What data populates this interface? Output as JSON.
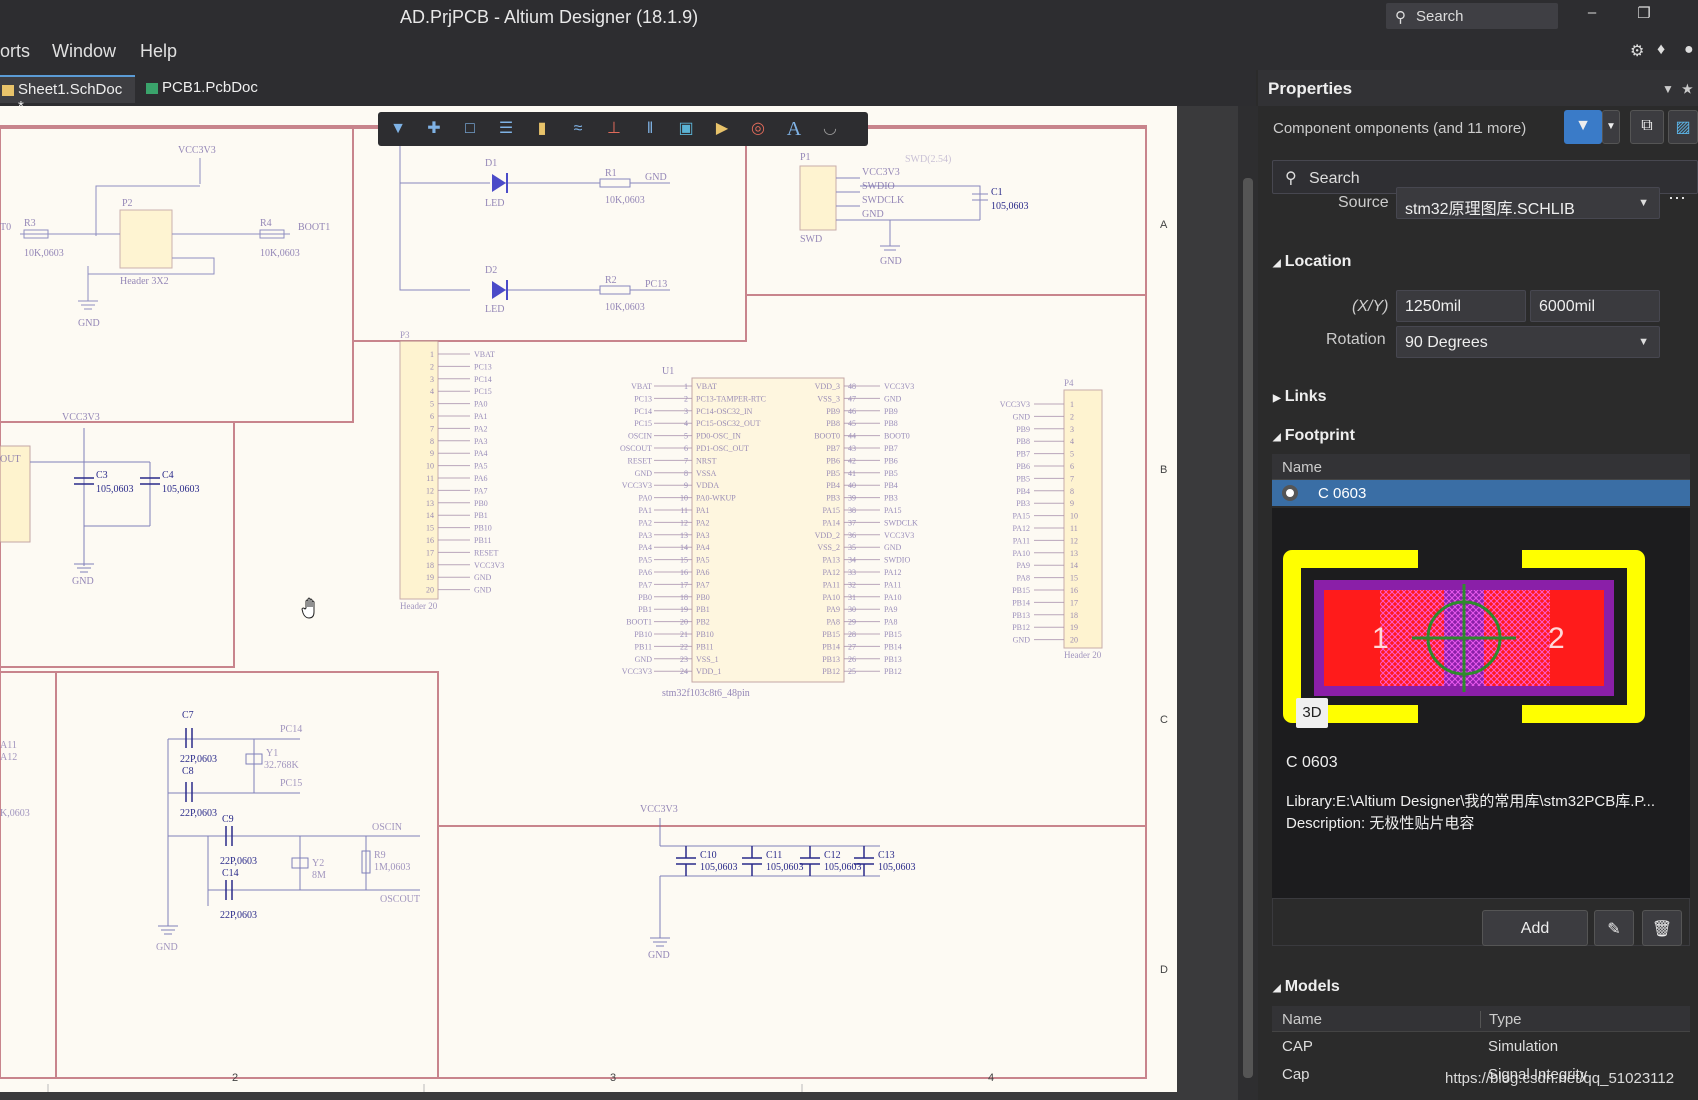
{
  "app": {
    "title": "AD.PrjPCB - Altium Designer (18.1.9)",
    "search_placeholder": "Search"
  },
  "menu": [
    "orts",
    "Window",
    "Help"
  ],
  "tabs": [
    {
      "label": "Sheet1.SchDoc *",
      "active": true
    },
    {
      "label": "PCB1.PcbDoc",
      "active": false
    }
  ],
  "schematic": {
    "border_rows": [
      "A",
      "B",
      "C",
      "D"
    ],
    "border_cols": [
      "2",
      "3",
      "4"
    ],
    "labels": {
      "vcc3v3_top": "VCC3V3",
      "p2": "P2",
      "p2_name": "Header 3X2",
      "r3": "R3",
      "r3_val": "10K,0603",
      "r4": "R4",
      "r4_val": "10K,0603",
      "boot1": "BOOT1",
      "gnd1": "GND",
      "to": "T0",
      "d1": "D1",
      "d1_type": "LED",
      "d2": "D2",
      "d2_type": "LED",
      "r1": "R1",
      "r1_val": "10K,0603",
      "r1_net": "GND",
      "r2": "R2",
      "r2_val": "10K,0603",
      "r2_net": "PC13",
      "vcc3v3_led": "VCC3V3",
      "p1": "P1",
      "swd_label": "SWD",
      "swd_nets": [
        "VCC3V3",
        "SWDIO",
        "SWDCLK",
        "GND"
      ],
      "swd_hdr": "SWD(2.54)",
      "c1": "C1",
      "c1_val": "105,0603",
      "gnd_swd": "GND",
      "p3": "P3",
      "p3_name": "Header 20",
      "p3_pins": [
        "1",
        "2",
        "3",
        "4",
        "5",
        "6",
        "7",
        "8",
        "9",
        "10",
        "11",
        "12",
        "13",
        "14",
        "15",
        "16",
        "17",
        "18",
        "19",
        "20"
      ],
      "p3_nets": [
        "VBAT",
        "PC13",
        "PC14",
        "PC15",
        "PA0",
        "PA1",
        "PA2",
        "PA3",
        "PA4",
        "PA5",
        "PA6",
        "PA7",
        "PB0",
        "PB1",
        "PB10",
        "PB11",
        "RESET",
        "VCC3V3",
        "GND",
        "GND"
      ],
      "u1": "U1",
      "u1_name": "stm32f103c8t6_48pin",
      "u1_left": [
        "VBAT",
        "PC13-TAMPER-RTC",
        "PC14-OSC32_IN",
        "PC15-OSC32_OUT",
        "PD0-OSC_IN",
        "PD1-OSC_OUT",
        "NRST",
        "VSSA",
        "VDDA",
        "PA0-WKUP",
        "PA1",
        "PA2",
        "PA3",
        "PA4",
        "PA5",
        "PA6",
        "PA7",
        "PB0",
        "PB1",
        "PB2",
        "PB10",
        "PB11",
        "VSS_1",
        "VDD_1"
      ],
      "u1_right": [
        "VDD_3",
        "VSS_3",
        "PB9",
        "PB8",
        "BOOT0",
        "PB7",
        "PB6",
        "PB5",
        "PB4",
        "PB3",
        "PA15",
        "PA14",
        "VDD_2",
        "VSS_2",
        "PA13",
        "PA12",
        "PA11",
        "PA10",
        "PA9",
        "PA8",
        "PB15",
        "PB14",
        "PB13",
        "PB12"
      ],
      "u1_lnets": [
        "VBAT",
        "PC13",
        "PC14",
        "PC15",
        "OSCIN",
        "OSCOUT",
        "RESET",
        "GND",
        "VCC3V3",
        "PA0",
        "PA1",
        "PA2",
        "PA3",
        "PA4",
        "PA5",
        "PA6",
        "PA7",
        "PB0",
        "PB1",
        "BOOT1",
        "PB10",
        "PB11",
        "GND",
        "VCC3V3"
      ],
      "u1_rnets": [
        "VCC3V3",
        "GND",
        "PB9",
        "PB8",
        "BOOT0",
        "PB7",
        "PB6",
        "PB5",
        "PB4",
        "PB3",
        "PA15",
        "SWDCLK",
        "VCC3V3",
        "GND",
        "SWDIO",
        "PA12",
        "PA11",
        "PA10",
        "PA9",
        "PA8",
        "PB15",
        "PB14",
        "PB13",
        "PB12"
      ],
      "u1_lnums": [
        "1",
        "2",
        "3",
        "4",
        "5",
        "6",
        "7",
        "8",
        "9",
        "10",
        "11",
        "12",
        "13",
        "14",
        "15",
        "16",
        "17",
        "18",
        "19",
        "20",
        "21",
        "22",
        "23",
        "24"
      ],
      "u1_rnums": [
        "48",
        "47",
        "46",
        "45",
        "44",
        "43",
        "42",
        "41",
        "40",
        "39",
        "38",
        "37",
        "36",
        "35",
        "34",
        "33",
        "32",
        "31",
        "30",
        "29",
        "28",
        "27",
        "26",
        "25"
      ],
      "p4": "P4",
      "p4_name": "Header 20",
      "p4_nets": [
        "VCC3V3",
        "GND",
        "PB9",
        "PB8",
        "PB7",
        "PB6",
        "PB5",
        "PB4",
        "PB3",
        "PA15",
        "PA12",
        "PA11",
        "PA10",
        "PA9",
        "PA8",
        "PB15",
        "PB14",
        "PB13",
        "PB12",
        "GND"
      ],
      "vcc3v3_caps": "VCC3V3",
      "c3": "C3",
      "c3_val": "105,0603",
      "c4": "C4",
      "c4_val": "105,0603",
      "gnd_caps": "GND",
      "out_label": "OUT",
      "c7": "C7",
      "c7_val": "22P,0603",
      "c8": "C8",
      "c8_val": "22P,0603",
      "y1": "Y1",
      "y1_val": "32.768K",
      "pc14": "PC14",
      "pc15": "PC15",
      "c9": "C9",
      "c9_val": "22P,0603",
      "c14": "C14",
      "c14_val": "22P,0603",
      "y2": "Y2",
      "y2_val": "8M",
      "r9": "R9",
      "r9_val": "1M,0603",
      "oscin": "OSCIN",
      "oscout": "OSCOUT",
      "gnd_osc": "GND",
      "a11": "A11",
      "a12": "A12",
      "k0603": "K,0603",
      "vcc3v3_dec": "VCC3V3",
      "c10": "C10",
      "c10_val": "105,0603",
      "c11": "C11",
      "c11_val": "105,0603",
      "c12": "C12",
      "c12_val": "105,0603",
      "c13": "C13",
      "c13_val": "105,0603",
      "gnd_dec": "GND"
    }
  },
  "toolbar_icons": [
    "filter-icon",
    "cross-icon",
    "select-rect-icon",
    "align-icon",
    "component-icon",
    "wire-icon",
    "power-port-icon",
    "bus-icon",
    "harness-icon",
    "port-icon",
    "directive-icon",
    "text-icon",
    "arc-icon"
  ],
  "properties": {
    "title": "Properties",
    "filter_text": "Component  omponents (and 11 more)",
    "search_placeholder": "Search",
    "source_label": "Source",
    "source_value": "stm32原理图库.SCHLIB",
    "location": {
      "title": "Location",
      "xy_label": "(X/Y)",
      "x": "1250mil",
      "y": "6000mil",
      "rotation_label": "Rotation",
      "rotation": "90 Degrees"
    },
    "links_title": "Links",
    "footprint": {
      "title": "Footprint",
      "col_name": "Name",
      "item": "C 0603",
      "badge_3d": "3D",
      "pad1": "1",
      "pad2": "2",
      "name": "C 0603",
      "library": "Library:E:\\Altium Designer\\我的常用库\\stm32PCB库.P...",
      "description": "Description: 无极性贴片电容",
      "add_label": "Add"
    },
    "models": {
      "title": "Models",
      "col_name": "Name",
      "col_type": "Type",
      "rows": [
        {
          "name": "CAP",
          "type": "Simulation"
        },
        {
          "name": "Cap",
          "type": "Signal Integrity"
        }
      ]
    }
  },
  "watermark": "https://blog.csdn.net/qq_51023112",
  "colors": {
    "sheet_bg": "#fdfaf3",
    "border": "#c8848c",
    "wire": "#2a2a8a",
    "pad": "#ff1b1b",
    "silk": "#ffff00",
    "selection": "#3a6ea5"
  }
}
